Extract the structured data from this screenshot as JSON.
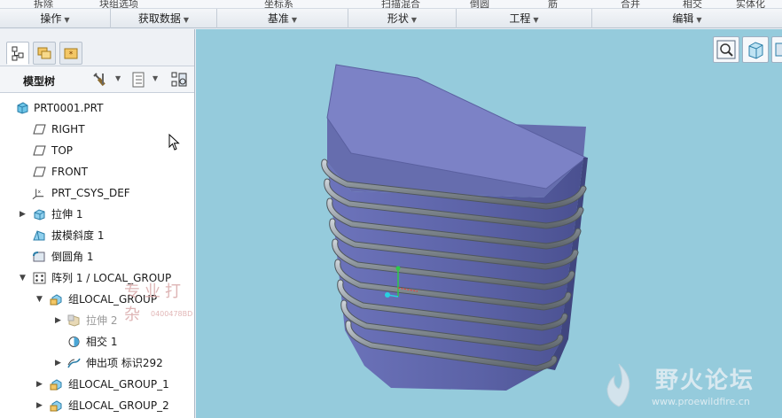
{
  "top_strip": {
    "items": [
      "拆除",
      "块组选项",
      "坐标系",
      "扫描混合",
      "倒圆",
      "筋",
      "合并",
      "相交",
      "实体化"
    ]
  },
  "ribbon_groups": [
    {
      "label": "操作"
    },
    {
      "label": "获取数据"
    },
    {
      "label": "基准"
    },
    {
      "label": "形状"
    },
    {
      "label": "工程"
    },
    {
      "label": "编辑"
    }
  ],
  "model_tree": {
    "title": "模型树",
    "items": [
      {
        "label": "PRT0001.PRT",
        "icon": "part-icon",
        "expand": ""
      },
      {
        "label": "RIGHT",
        "icon": "datum-plane-icon",
        "expand": ""
      },
      {
        "label": "TOP",
        "icon": "datum-plane-icon",
        "expand": ""
      },
      {
        "label": "FRONT",
        "icon": "datum-plane-icon",
        "expand": ""
      },
      {
        "label": "PRT_CSYS_DEF",
        "icon": "csys-icon",
        "expand": ""
      },
      {
        "label": "拉伸 1",
        "icon": "extrude-icon",
        "expand": "▶"
      },
      {
        "label": "拔模斜度 1",
        "icon": "draft-icon",
        "expand": ""
      },
      {
        "label": "倒圆角 1",
        "icon": "round-icon",
        "expand": ""
      },
      {
        "label": "阵列 1 / LOCAL_GROUP",
        "icon": "pattern-icon",
        "expand": "▼"
      },
      {
        "label": "组LOCAL_GROUP",
        "icon": "group-icon",
        "expand": "▼"
      },
      {
        "label": "拉伸 2",
        "icon": "extrude-dim-icon",
        "expand": "▶",
        "dim": true
      },
      {
        "label": "相交 1",
        "icon": "intersect-icon",
        "expand": ""
      },
      {
        "label": "伸出项 标识292",
        "icon": "protrusion-icon",
        "expand": "▶"
      },
      {
        "label": "组LOCAL_GROUP_1",
        "icon": "group-icon",
        "expand": "▶"
      },
      {
        "label": "组LOCAL_GROUP_2",
        "icon": "group-icon",
        "expand": "▶"
      }
    ]
  },
  "watermark": {
    "text": "专业打杂",
    "number": "0400478BD"
  },
  "forum_logo": {
    "name": "野火论坛",
    "url": "www.proewildfire.cn"
  },
  "colors": {
    "viewport_bg": "#95cbdc",
    "model_top": "#7c82c6",
    "model_side": "#5c63a8",
    "spring": "#8f979e"
  }
}
